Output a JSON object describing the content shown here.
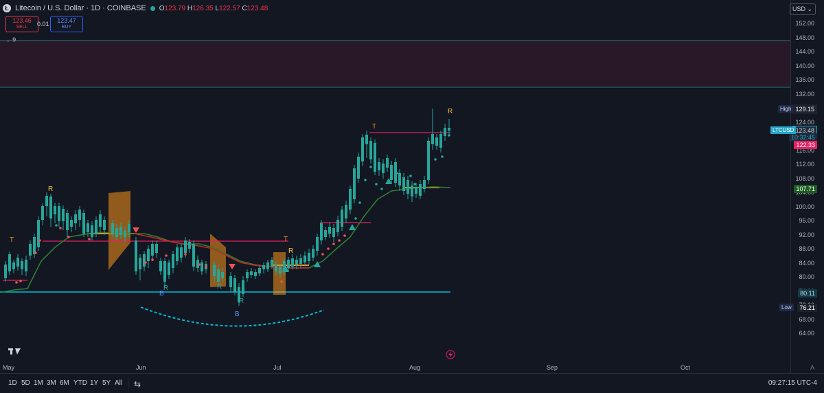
{
  "header": {
    "coin_icon": "litecoin-icon",
    "title": "Litecoin / U.S. Dollar · 1D · COINBASE",
    "status_color": "#26a69a",
    "ohlc": {
      "o_label": "O",
      "o": "123.79",
      "h_label": "H",
      "h": "126.35",
      "l_label": "L",
      "l": "122.57",
      "c_label": "C",
      "c": "123.48"
    }
  },
  "trade": {
    "sell_price": "123.46",
    "sell_label": "SELL",
    "spread": "0.01",
    "buy_price": "123.47",
    "buy_label": "BUY"
  },
  "indicator_toggle": "9",
  "axis": {
    "currency": "USD",
    "ticks": [
      "152.00",
      "148.00",
      "144.00",
      "140.00",
      "136.00",
      "132.00",
      "128.00",
      "124.00",
      "120.00",
      "116.00",
      "112.00",
      "108.00",
      "104.00",
      "100.00",
      "96.00",
      "92.00",
      "88.00",
      "84.00",
      "80.00",
      "76.00",
      "72.00",
      "68.00",
      "64.00"
    ],
    "high_label": "High",
    "high": "129.15",
    "symbol": "LTCUSD",
    "last": "123.48",
    "countdown": "10:32:45",
    "red_level": "122.33",
    "green_level": "107.71",
    "cyan_level": "80.11",
    "low_label": "Low",
    "low": "76.21",
    "auto_label": "A"
  },
  "months": [
    "May",
    "Jun",
    "Jul",
    "Aug",
    "Sep",
    "Oct"
  ],
  "toolbar": {
    "timeframes": [
      "1D",
      "5D",
      "1M",
      "3M",
      "6M",
      "YTD",
      "1Y",
      "5Y",
      "All"
    ],
    "compare_icon": "calendar-range-icon",
    "clock": "09:27:15 UTC-4"
  },
  "chart_markers": {
    "T": "T",
    "R": "R",
    "B": "B"
  },
  "colors": {
    "up": "#26a69a",
    "down": "#ef5350",
    "orange": "#f7931a",
    "cyan": "#00bcd4",
    "red_line": "#e91e63",
    "green_line": "#2e7d32"
  }
}
